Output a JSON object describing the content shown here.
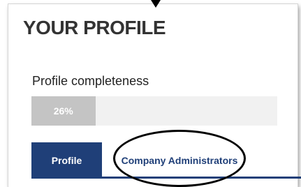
{
  "page": {
    "title": "YOUR PROFILE"
  },
  "completeness": {
    "label": "Profile completeness",
    "percent_text": "26%",
    "value": 0.26
  },
  "tabs": [
    {
      "label": "Profile",
      "active": true
    },
    {
      "label": "Company Administrators",
      "active": false
    }
  ],
  "colors": {
    "brand": "#1f3f78",
    "progress_fill": "#c4c4c4",
    "progress_track": "#f1f1f1"
  },
  "annotations": {
    "highlight": "oval-around-company-administrators-tab",
    "pointer": "arrow-down-icon"
  }
}
